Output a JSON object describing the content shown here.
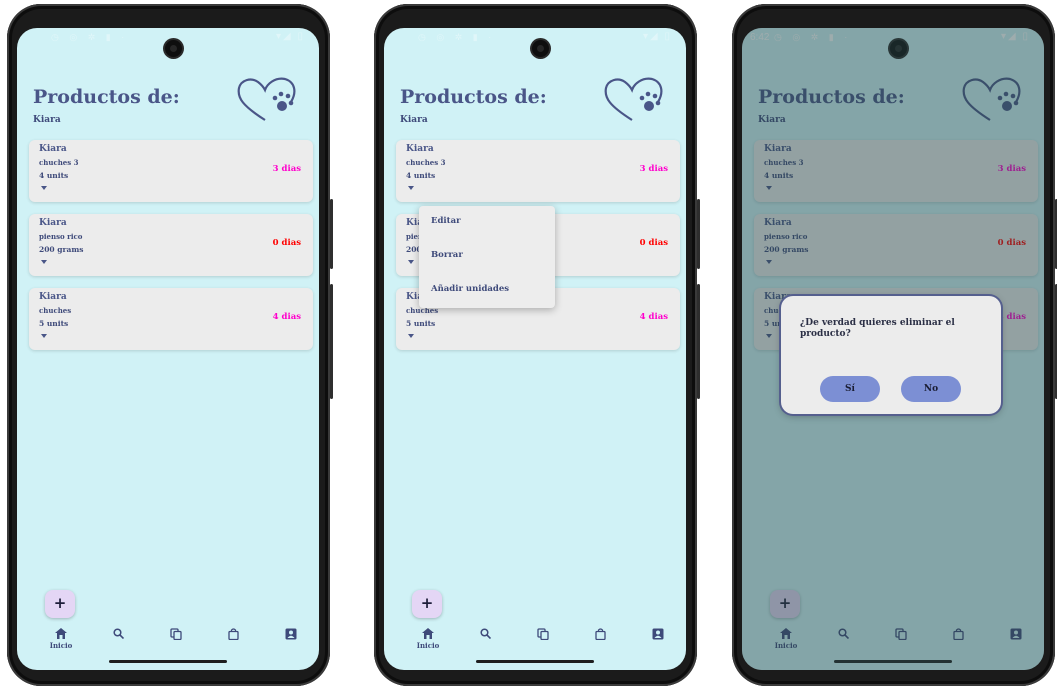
{
  "colors": {
    "background": "#d0f2f6",
    "card": "#ececec",
    "accent": "#4a5688",
    "days_pink": "#ff00cc",
    "days_red": "#ff0000",
    "fab": "#e4d6f5",
    "dialog_button": "#7c8fd4"
  },
  "status": {
    "time_third": "6:42"
  },
  "page": {
    "title": "Productos de:",
    "subtitle": "Kiara"
  },
  "products": [
    {
      "pet": "Kiara",
      "name": "chuches 3",
      "quantity": "4 units",
      "days": "3 dias",
      "days_color": "#ff00cc"
    },
    {
      "pet": "Kiara",
      "name": "pienso rico",
      "quantity": "200 grams",
      "days": "0 dias",
      "days_color": "#ff0000"
    },
    {
      "pet": "Kiara",
      "name": "chuches",
      "quantity": "5 units",
      "days": "4 dias",
      "days_color": "#ff00cc"
    }
  ],
  "fab_label": "+",
  "nav": {
    "items": [
      {
        "icon": "home-icon",
        "label": "Inicio"
      },
      {
        "icon": "search-icon"
      },
      {
        "icon": "copy-icon"
      },
      {
        "icon": "shopping-bag-icon"
      },
      {
        "icon": "profile-icon"
      }
    ]
  },
  "context_menu": {
    "items": [
      "Editar",
      "Borrar",
      "Añadir unidades"
    ]
  },
  "dialog": {
    "question": "¿De verdad quieres eliminar el producto?",
    "yes": "Sí",
    "no": "No"
  }
}
